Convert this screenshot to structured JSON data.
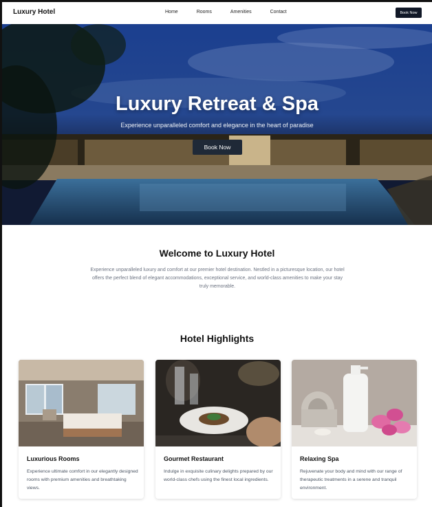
{
  "nav": {
    "brand": "Luxury Hotel",
    "links": [
      "Home",
      "Rooms",
      "Amenities",
      "Contact"
    ],
    "book_label": "Book Now"
  },
  "hero": {
    "title": "Luxury Retreat & Spa",
    "subtitle": "Experience unparalleled comfort and elegance in the heart of paradise",
    "button_label": "Book Now"
  },
  "welcome": {
    "title": "Welcome to Luxury Hotel",
    "text": "Experience unparalleled luxury and comfort at our premier hotel destination. Nestled in a picturesque location, our hotel offers the perfect blend of elegant accommodations, exceptional service, and world-class amenities to make your stay truly memorable."
  },
  "highlights": {
    "title": "Hotel Highlights",
    "cards": [
      {
        "title": "Luxurious Rooms",
        "text": "Experience ultimate comfort in our elegantly designed rooms with premium amenities and breathtaking views."
      },
      {
        "title": "Gourmet Restaurant",
        "text": "Indulge in exquisite culinary delights prepared by our world-class chefs using the finest local ingredients."
      },
      {
        "title": "Relaxing Spa",
        "text": "Rejuvenate your body and mind with our range of therapeutic treatments in a serene and tranquil environment."
      }
    ]
  },
  "colors": {
    "dark_button": "#111827",
    "hero_sky": "#1e3a8a",
    "muted_text": "#6b7280"
  }
}
